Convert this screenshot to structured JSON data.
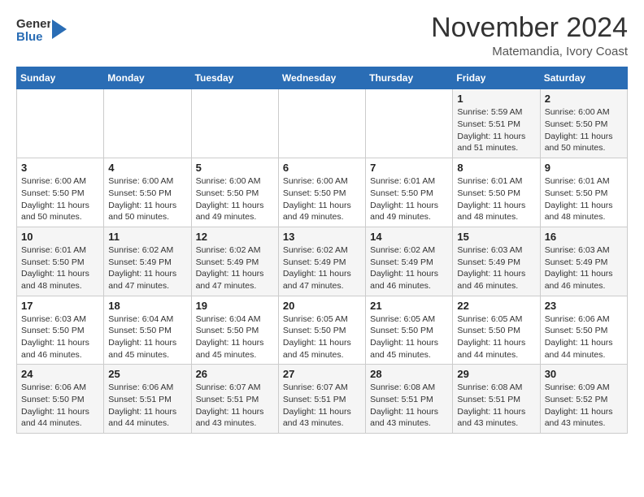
{
  "header": {
    "logo_general": "General",
    "logo_blue": "Blue",
    "month": "November 2024",
    "location": "Matemandia, Ivory Coast"
  },
  "days_of_week": [
    "Sunday",
    "Monday",
    "Tuesday",
    "Wednesday",
    "Thursday",
    "Friday",
    "Saturday"
  ],
  "weeks": [
    [
      {
        "day": "",
        "info": ""
      },
      {
        "day": "",
        "info": ""
      },
      {
        "day": "",
        "info": ""
      },
      {
        "day": "",
        "info": ""
      },
      {
        "day": "",
        "info": ""
      },
      {
        "day": "1",
        "info": "Sunrise: 5:59 AM\nSunset: 5:51 PM\nDaylight: 11 hours\nand 51 minutes."
      },
      {
        "day": "2",
        "info": "Sunrise: 6:00 AM\nSunset: 5:50 PM\nDaylight: 11 hours\nand 50 minutes."
      }
    ],
    [
      {
        "day": "3",
        "info": "Sunrise: 6:00 AM\nSunset: 5:50 PM\nDaylight: 11 hours\nand 50 minutes."
      },
      {
        "day": "4",
        "info": "Sunrise: 6:00 AM\nSunset: 5:50 PM\nDaylight: 11 hours\nand 50 minutes."
      },
      {
        "day": "5",
        "info": "Sunrise: 6:00 AM\nSunset: 5:50 PM\nDaylight: 11 hours\nand 49 minutes."
      },
      {
        "day": "6",
        "info": "Sunrise: 6:00 AM\nSunset: 5:50 PM\nDaylight: 11 hours\nand 49 minutes."
      },
      {
        "day": "7",
        "info": "Sunrise: 6:01 AM\nSunset: 5:50 PM\nDaylight: 11 hours\nand 49 minutes."
      },
      {
        "day": "8",
        "info": "Sunrise: 6:01 AM\nSunset: 5:50 PM\nDaylight: 11 hours\nand 48 minutes."
      },
      {
        "day": "9",
        "info": "Sunrise: 6:01 AM\nSunset: 5:50 PM\nDaylight: 11 hours\nand 48 minutes."
      }
    ],
    [
      {
        "day": "10",
        "info": "Sunrise: 6:01 AM\nSunset: 5:50 PM\nDaylight: 11 hours\nand 48 minutes."
      },
      {
        "day": "11",
        "info": "Sunrise: 6:02 AM\nSunset: 5:49 PM\nDaylight: 11 hours\nand 47 minutes."
      },
      {
        "day": "12",
        "info": "Sunrise: 6:02 AM\nSunset: 5:49 PM\nDaylight: 11 hours\nand 47 minutes."
      },
      {
        "day": "13",
        "info": "Sunrise: 6:02 AM\nSunset: 5:49 PM\nDaylight: 11 hours\nand 47 minutes."
      },
      {
        "day": "14",
        "info": "Sunrise: 6:02 AM\nSunset: 5:49 PM\nDaylight: 11 hours\nand 46 minutes."
      },
      {
        "day": "15",
        "info": "Sunrise: 6:03 AM\nSunset: 5:49 PM\nDaylight: 11 hours\nand 46 minutes."
      },
      {
        "day": "16",
        "info": "Sunrise: 6:03 AM\nSunset: 5:49 PM\nDaylight: 11 hours\nand 46 minutes."
      }
    ],
    [
      {
        "day": "17",
        "info": "Sunrise: 6:03 AM\nSunset: 5:50 PM\nDaylight: 11 hours\nand 46 minutes."
      },
      {
        "day": "18",
        "info": "Sunrise: 6:04 AM\nSunset: 5:50 PM\nDaylight: 11 hours\nand 45 minutes."
      },
      {
        "day": "19",
        "info": "Sunrise: 6:04 AM\nSunset: 5:50 PM\nDaylight: 11 hours\nand 45 minutes."
      },
      {
        "day": "20",
        "info": "Sunrise: 6:05 AM\nSunset: 5:50 PM\nDaylight: 11 hours\nand 45 minutes."
      },
      {
        "day": "21",
        "info": "Sunrise: 6:05 AM\nSunset: 5:50 PM\nDaylight: 11 hours\nand 45 minutes."
      },
      {
        "day": "22",
        "info": "Sunrise: 6:05 AM\nSunset: 5:50 PM\nDaylight: 11 hours\nand 44 minutes."
      },
      {
        "day": "23",
        "info": "Sunrise: 6:06 AM\nSunset: 5:50 PM\nDaylight: 11 hours\nand 44 minutes."
      }
    ],
    [
      {
        "day": "24",
        "info": "Sunrise: 6:06 AM\nSunset: 5:50 PM\nDaylight: 11 hours\nand 44 minutes."
      },
      {
        "day": "25",
        "info": "Sunrise: 6:06 AM\nSunset: 5:51 PM\nDaylight: 11 hours\nand 44 minutes."
      },
      {
        "day": "26",
        "info": "Sunrise: 6:07 AM\nSunset: 5:51 PM\nDaylight: 11 hours\nand 43 minutes."
      },
      {
        "day": "27",
        "info": "Sunrise: 6:07 AM\nSunset: 5:51 PM\nDaylight: 11 hours\nand 43 minutes."
      },
      {
        "day": "28",
        "info": "Sunrise: 6:08 AM\nSunset: 5:51 PM\nDaylight: 11 hours\nand 43 minutes."
      },
      {
        "day": "29",
        "info": "Sunrise: 6:08 AM\nSunset: 5:51 PM\nDaylight: 11 hours\nand 43 minutes."
      },
      {
        "day": "30",
        "info": "Sunrise: 6:09 AM\nSunset: 5:52 PM\nDaylight: 11 hours\nand 43 minutes."
      }
    ]
  ]
}
